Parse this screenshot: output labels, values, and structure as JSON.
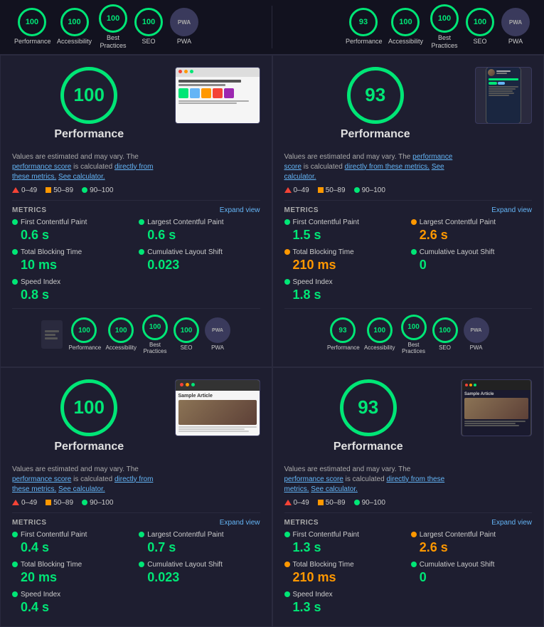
{
  "topbar": {
    "left": {
      "items": [
        {
          "score": "100",
          "label": "Performance",
          "type": "green"
        },
        {
          "score": "100",
          "label": "Accessibility",
          "type": "green"
        },
        {
          "score": "100",
          "label": "Best\nPractices",
          "type": "green"
        },
        {
          "score": "100",
          "label": "SEO",
          "type": "green"
        },
        {
          "score": "PWA",
          "label": "PWA",
          "type": "pwa"
        }
      ]
    },
    "right": {
      "items": [
        {
          "score": "93",
          "label": "Performance",
          "type": "green"
        },
        {
          "score": "100",
          "label": "Accessibility",
          "type": "green"
        },
        {
          "score": "100",
          "label": "Best\nPractices",
          "type": "green"
        },
        {
          "score": "100",
          "label": "SEO",
          "type": "green"
        },
        {
          "score": "PWA",
          "label": "PWA",
          "type": "pwa"
        }
      ]
    }
  },
  "panels": [
    {
      "id": "panel1",
      "score": "100",
      "title": "Performance",
      "desc_main": "Values are estimated and may vary. The",
      "desc_link1": "performance score",
      "desc_mid": "is calculated",
      "desc_link2": "directly from these metrics.",
      "desc_end": "See calculator.",
      "legend": [
        "0–49",
        "50–89",
        "90–100"
      ],
      "metrics_label": "METRICS",
      "expand_label": "Expand view",
      "metrics": [
        {
          "name": "First Contentful Paint",
          "value": "0.6 s",
          "color": "green"
        },
        {
          "name": "Largest Contentful Paint",
          "value": "0.6 s",
          "color": "green"
        },
        {
          "name": "Total Blocking Time",
          "value": "10 ms",
          "color": "green"
        },
        {
          "name": "Cumulative Layout Shift",
          "value": "0.023",
          "color": "green"
        },
        {
          "name": "Speed Index",
          "value": "0.8 s",
          "color": "green"
        }
      ],
      "bottom_scores": [
        {
          "score": "100",
          "label": "Performance",
          "type": "green"
        },
        {
          "score": "100",
          "label": "Accessibility",
          "type": "green"
        },
        {
          "score": "100",
          "label": "Best\nPractices",
          "type": "green"
        },
        {
          "score": "100",
          "label": "SEO",
          "type": "green"
        },
        {
          "score": "PWA",
          "label": "PWA",
          "type": "pwa"
        }
      ]
    },
    {
      "id": "panel2",
      "score": "93",
      "title": "Performance",
      "desc_main": "Values are estimated and may vary. The",
      "desc_link1": "performance score",
      "desc_mid": "is calculated",
      "desc_link2": "directly from these metrics.",
      "desc_end": "See calculator.",
      "legend": [
        "0–49",
        "50–89",
        "90–100"
      ],
      "metrics_label": "METRICS",
      "expand_label": "Expand view",
      "metrics": [
        {
          "name": "First Contentful Paint",
          "value": "1.5 s",
          "color": "green"
        },
        {
          "name": "Largest Contentful Paint",
          "value": "2.6 s",
          "color": "orange"
        },
        {
          "name": "Total Blocking Time",
          "value": "210 ms",
          "color": "orange"
        },
        {
          "name": "Cumulative Layout Shift",
          "value": "0",
          "color": "green"
        },
        {
          "name": "Speed Index",
          "value": "1.8 s",
          "color": "green"
        }
      ],
      "bottom_scores": [
        {
          "score": "93",
          "label": "Performance",
          "type": "green"
        },
        {
          "score": "100",
          "label": "Accessibility",
          "type": "green"
        },
        {
          "score": "100",
          "label": "Best\nPractices",
          "type": "green"
        },
        {
          "score": "100",
          "label": "SEO",
          "type": "green"
        },
        {
          "score": "PWA",
          "label": "PWA",
          "type": "pwa"
        }
      ]
    },
    {
      "id": "panel3",
      "score": "100",
      "title": "Performance",
      "desc_main": "Values are estimated and may vary. The",
      "desc_link1": "performance score",
      "desc_mid": "is calculated",
      "desc_link2": "directly from these metrics.",
      "desc_end": "See calculator.",
      "legend": [
        "0–49",
        "50–89",
        "90–100"
      ],
      "metrics_label": "METRICS",
      "expand_label": "Expand view",
      "metrics": [
        {
          "name": "First Contentful Paint",
          "value": "0.4 s",
          "color": "green"
        },
        {
          "name": "Largest Contentful Paint",
          "value": "0.7 s",
          "color": "green"
        },
        {
          "name": "Total Blocking Time",
          "value": "20 ms",
          "color": "green"
        },
        {
          "name": "Cumulative Layout Shift",
          "value": "0.023",
          "color": "green"
        },
        {
          "name": "Speed Index",
          "value": "0.4 s",
          "color": "green"
        }
      ],
      "bottom_scores": []
    },
    {
      "id": "panel4",
      "score": "93",
      "title": "Performance",
      "desc_main": "Values are estimated and may vary. The",
      "desc_link1": "performance score",
      "desc_mid": "is calculated",
      "desc_link2": "directly from these metrics.",
      "desc_end": "See calculator.",
      "legend": [
        "0–49",
        "50–89",
        "90–100"
      ],
      "metrics_label": "METRICS",
      "expand_label": "Expand view",
      "metrics": [
        {
          "name": "First Contentful Paint",
          "value": "1.3 s",
          "color": "green"
        },
        {
          "name": "Largest Contentful Paint",
          "value": "2.6 s",
          "color": "orange"
        },
        {
          "name": "Total Blocking Time",
          "value": "210 ms",
          "color": "orange"
        },
        {
          "name": "Cumulative Layout Shift",
          "value": "0",
          "color": "green"
        },
        {
          "name": "Speed Index",
          "value": "1.3 s",
          "color": "green"
        }
      ],
      "bottom_scores": []
    }
  ]
}
